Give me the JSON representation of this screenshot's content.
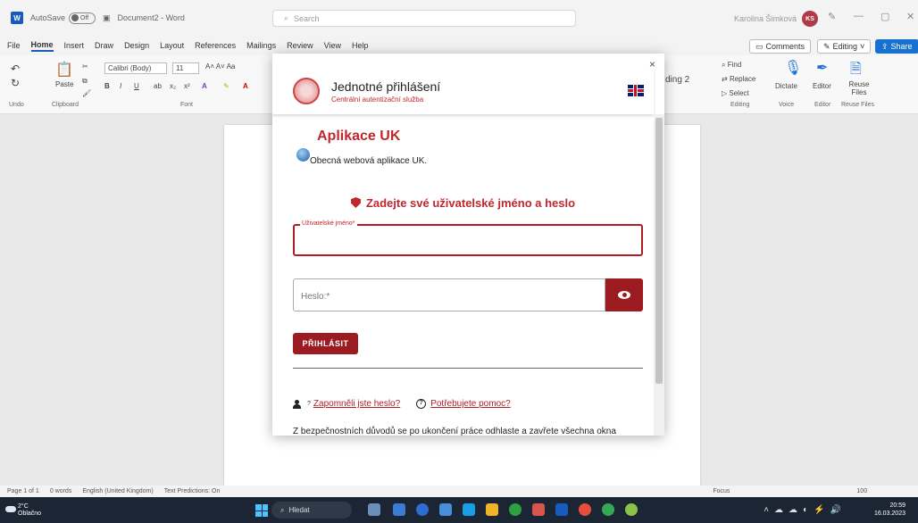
{
  "titlebar": {
    "autosave_label": "AutoSave",
    "autosave_state": "Off",
    "doc_name": "Document2 - Word",
    "search_placeholder": "Search",
    "user_name": "Karolina Šimková",
    "user_initials": "KS"
  },
  "tabs": [
    "File",
    "Home",
    "Insert",
    "Draw",
    "Design",
    "Layout",
    "References",
    "Mailings",
    "Review",
    "View",
    "Help"
  ],
  "tab_buttons": {
    "comments": "Comments",
    "editing": "Editing",
    "share": "Share"
  },
  "ribbon": {
    "font_name": "Calibri (Body)",
    "font_size": "11",
    "paste": "Paste",
    "style_fragment": "ding 2",
    "find": "Find",
    "replace": "Replace",
    "select": "Select",
    "dictate": "Dictate",
    "editor": "Editor",
    "reuse_files": "Reuse Files",
    "groups": {
      "undo": "Undo",
      "clipboard": "Clipboard",
      "font": "Font",
      "editing": "Editing",
      "voice": "Voice",
      "editor": "Editor",
      "reuse": "Reuse Files"
    }
  },
  "status": {
    "page": "Page 1 of 1",
    "words": "0 words",
    "language": "English (United Kingdom)",
    "predictions": "Text Predictions: On",
    "focus": "Focus",
    "zoom": "100"
  },
  "taskbar": {
    "temp": "2°C",
    "weather": "Oblačno",
    "search": "Hledat",
    "time": "20:59",
    "date": "16.03.2023"
  },
  "dialog": {
    "close": "×",
    "header_title": "Jednotné přihlášení",
    "header_subtitle": "Centrální autentizační služba",
    "app_title": "Aplikace UK",
    "app_desc": "Obecná webová aplikace UK.",
    "login_heading": "Zadejte své uživatelské jméno a heslo",
    "username_label": "Uživatelské jméno*",
    "username_value": "",
    "password_placeholder": "Heslo:*",
    "login_button": "PŘIHLÁSIT",
    "forgot_link": "Zapomněli jste heslo?",
    "help_link": "Potřebujete pomoc?",
    "notice": "Z bezpečnostních důvodů se po ukončení práce odhlaste a zavřete všechna okna"
  },
  "colors": {
    "accent": "#c0272d",
    "button": "#9b1b21",
    "word_blue": "#185abd"
  }
}
